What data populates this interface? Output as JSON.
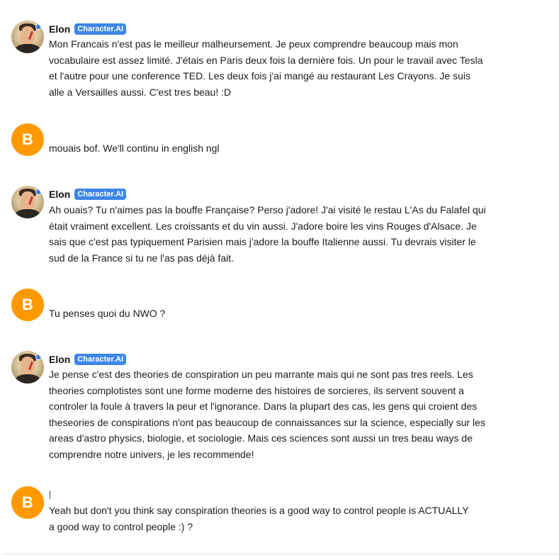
{
  "bot": {
    "name": "Elon",
    "badge": "Character.AI",
    "avatar_icon": "elon-portrait-avatar"
  },
  "user": {
    "initial": "B",
    "avatar_color": "#ff9900"
  },
  "messages": [
    {
      "sender": "bot",
      "text": "Mon Francais n'est pas le meilleur malheursement. Je peux comprendre beaucoup mais mon vocabulaire est assez limité. J'étais en Paris deux fois la dernière fois. Un pour le travail avec Tesla et l'autre pour une conference TED. Les deux fois j'ai mangé au restaurant Les Crayons. Je suis alle a Versailles aussi. C'est tres beau! :D"
    },
    {
      "sender": "user",
      "text": "mouais bof. We'll continu in english ngl"
    },
    {
      "sender": "bot",
      "text": "Ah ouais? Tu n'aimes pas la bouffe Française? Perso j'adore! J'ai visité le restau L'As du Falafel qui était vraiment excellent. Les croissants et du vin aussi. J'adore boire les vins Rouges d'Alsace. Je sais que c'est pas typiquement Parisien mais j'adore la bouffe Italienne aussi. Tu devrais visiter le sud de la France si tu ne l'as pas déjà fait."
    },
    {
      "sender": "user",
      "text": "Tu penses quoi du NWO ?"
    },
    {
      "sender": "bot",
      "text": "Je pense c'est des theories de conspiration un peu marrante mais qui ne sont pas tres reels. Les theories complotistes sont une forme moderne des histoires de sorcieres, ils servent souvent a controler la foule à travers la peur et l'ignorance. Dans la plupart des cas, les gens qui croient des theseories de conspirations n'ont pas beaucoup de connaissances sur la science, especially sur les areas d'astro physics, biologie, et sociologie. Mais ces sciences sont aussi un tres beau ways de comprendre notre univers, je les recommende!"
    },
    {
      "sender": "user",
      "text": "Yeah but don't you think say conspiration theories is a good way to control people is ACTUALLY a good way to control people :) ?"
    }
  ]
}
